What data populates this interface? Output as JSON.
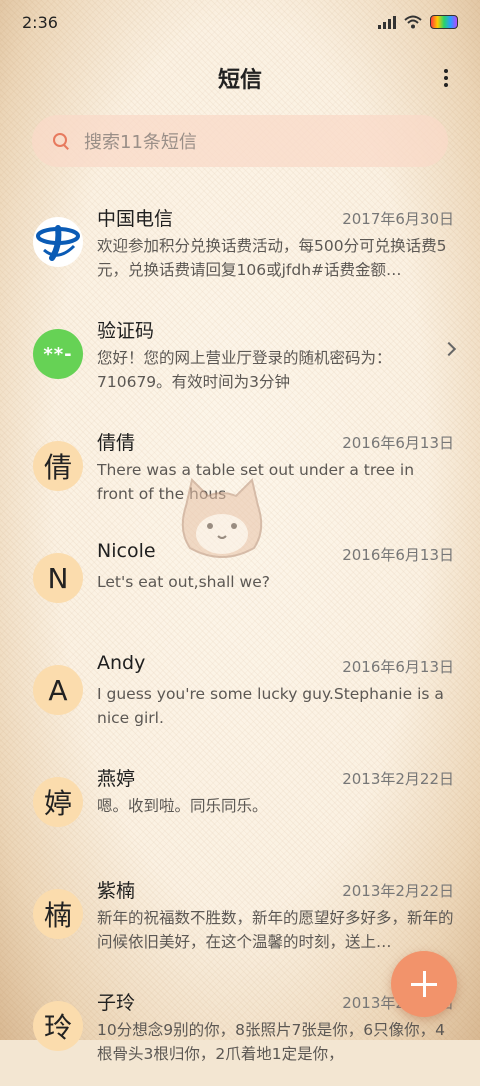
{
  "status": {
    "time": "2:36"
  },
  "header": {
    "title": "短信"
  },
  "search": {
    "placeholder": "搜索11条短信"
  },
  "conversations": [
    {
      "name": "中国电信",
      "date": "2017年6月30日",
      "preview": "欢迎参加积分兑换话费活动，每500分可兑换话费5元，兑换话费请回复106或jfdh#话费金额…",
      "avatar_type": "telecom-logo"
    },
    {
      "name": "验证码",
      "date": "",
      "preview": "您好！您的网上营业厅登录的随机密码为：710679。有效时间为3分钟",
      "avatar_text": "**-"
    },
    {
      "name": "倩倩",
      "date": "2016年6月13日",
      "preview": "There was a table set out under a tree in front of the hous",
      "avatar_text": "倩"
    },
    {
      "name": "Nicole",
      "date": "2016年6月13日",
      "preview": "Let's eat out,shall we?",
      "avatar_text": "N"
    },
    {
      "name": "Andy",
      "date": "2016年6月13日",
      "preview": "I guess you're some lucky guy.Stephanie is a nice girl.",
      "avatar_text": "A"
    },
    {
      "name": "燕婷",
      "date": "2013年2月22日",
      "preview": "嗯。收到啦。同乐同乐。",
      "avatar_text": "婷"
    },
    {
      "name": "紫楠",
      "date": "2013年2月22日",
      "preview": "新年的祝福数不胜数，新年的愿望好多好多，新年的问候依旧美好，在这个温馨的时刻，送上…",
      "avatar_text": "楠"
    },
    {
      "name": "子玲",
      "date": "2013年2月22日",
      "preview": "10分想念9别的你，8张照片7张是你，6只像你，4根骨头3根归你，2爪着地1定是你，",
      "avatar_text": "玲"
    }
  ],
  "colors": {
    "accent": "#f2936b",
    "search_bg": "#fadac8",
    "avatar_bg": "#fbdcad",
    "code_avatar": "#66d255"
  },
  "icons": {
    "search": "search-icon",
    "more": "more-vertical-icon",
    "compose": "plus-icon",
    "chevron": "chevron-right-icon"
  }
}
